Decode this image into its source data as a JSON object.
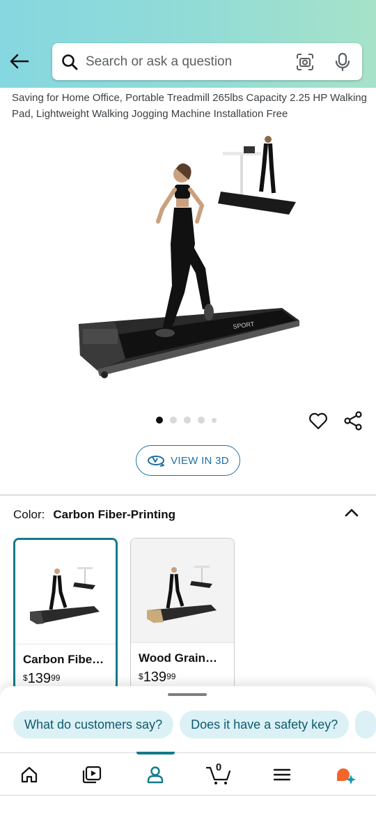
{
  "search": {
    "placeholder": "Search or ask a question"
  },
  "product": {
    "title": "Saving for Home Office, Portable Treadmill 265lbs Capacity 2.25 HP Walking Pad, Lightweight Walking Jogging Machine Installation Free",
    "image_brand_text": "SPORT",
    "carousel": {
      "total": 5,
      "active": 1
    },
    "view3d_label": "VIEW IN 3D"
  },
  "color": {
    "label": "Color:",
    "selected": "Carbon Fiber-Printing",
    "options": [
      {
        "name": "Carbon Fibe…",
        "currency": "$",
        "whole": "139",
        "cents": "99",
        "selected": true
      },
      {
        "name": "Wood Grain…",
        "currency": "$",
        "whole": "139",
        "cents": "99",
        "selected": false
      }
    ]
  },
  "chips": [
    "What do customers say?",
    "Does it have a safety key?"
  ],
  "nav": {
    "cart_count": "0",
    "active_tab": "account",
    "tabs": [
      "home-icon",
      "video-icon",
      "account-icon",
      "cart-icon",
      "menu-icon",
      "rufus-icon"
    ]
  },
  "colors": {
    "accent": "#137a8a",
    "link": "#1e6fa5",
    "chip_bg": "#dbf1f5",
    "header_start": "#85d7e0",
    "header_end": "#a6e2c8"
  }
}
